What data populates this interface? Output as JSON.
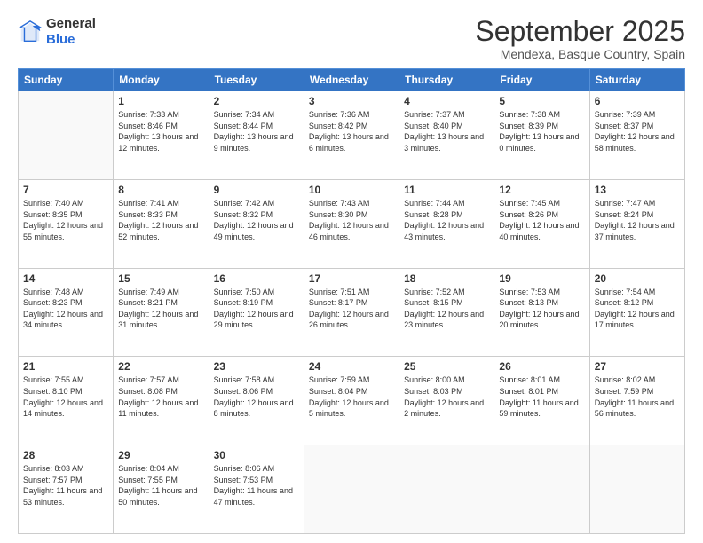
{
  "logo": {
    "general": "General",
    "blue": "Blue"
  },
  "title": {
    "month": "September 2025",
    "location": "Mendexa, Basque Country, Spain"
  },
  "weekdays": [
    "Sunday",
    "Monday",
    "Tuesday",
    "Wednesday",
    "Thursday",
    "Friday",
    "Saturday"
  ],
  "weeks": [
    [
      {
        "day": "",
        "sunrise": "",
        "sunset": "",
        "daylight": ""
      },
      {
        "day": "1",
        "sunrise": "Sunrise: 7:33 AM",
        "sunset": "Sunset: 8:46 PM",
        "daylight": "Daylight: 13 hours and 12 minutes."
      },
      {
        "day": "2",
        "sunrise": "Sunrise: 7:34 AM",
        "sunset": "Sunset: 8:44 PM",
        "daylight": "Daylight: 13 hours and 9 minutes."
      },
      {
        "day": "3",
        "sunrise": "Sunrise: 7:36 AM",
        "sunset": "Sunset: 8:42 PM",
        "daylight": "Daylight: 13 hours and 6 minutes."
      },
      {
        "day": "4",
        "sunrise": "Sunrise: 7:37 AM",
        "sunset": "Sunset: 8:40 PM",
        "daylight": "Daylight: 13 hours and 3 minutes."
      },
      {
        "day": "5",
        "sunrise": "Sunrise: 7:38 AM",
        "sunset": "Sunset: 8:39 PM",
        "daylight": "Daylight: 13 hours and 0 minutes."
      },
      {
        "day": "6",
        "sunrise": "Sunrise: 7:39 AM",
        "sunset": "Sunset: 8:37 PM",
        "daylight": "Daylight: 12 hours and 58 minutes."
      }
    ],
    [
      {
        "day": "7",
        "sunrise": "Sunrise: 7:40 AM",
        "sunset": "Sunset: 8:35 PM",
        "daylight": "Daylight: 12 hours and 55 minutes."
      },
      {
        "day": "8",
        "sunrise": "Sunrise: 7:41 AM",
        "sunset": "Sunset: 8:33 PM",
        "daylight": "Daylight: 12 hours and 52 minutes."
      },
      {
        "day": "9",
        "sunrise": "Sunrise: 7:42 AM",
        "sunset": "Sunset: 8:32 PM",
        "daylight": "Daylight: 12 hours and 49 minutes."
      },
      {
        "day": "10",
        "sunrise": "Sunrise: 7:43 AM",
        "sunset": "Sunset: 8:30 PM",
        "daylight": "Daylight: 12 hours and 46 minutes."
      },
      {
        "day": "11",
        "sunrise": "Sunrise: 7:44 AM",
        "sunset": "Sunset: 8:28 PM",
        "daylight": "Daylight: 12 hours and 43 minutes."
      },
      {
        "day": "12",
        "sunrise": "Sunrise: 7:45 AM",
        "sunset": "Sunset: 8:26 PM",
        "daylight": "Daylight: 12 hours and 40 minutes."
      },
      {
        "day": "13",
        "sunrise": "Sunrise: 7:47 AM",
        "sunset": "Sunset: 8:24 PM",
        "daylight": "Daylight: 12 hours and 37 minutes."
      }
    ],
    [
      {
        "day": "14",
        "sunrise": "Sunrise: 7:48 AM",
        "sunset": "Sunset: 8:23 PM",
        "daylight": "Daylight: 12 hours and 34 minutes."
      },
      {
        "day": "15",
        "sunrise": "Sunrise: 7:49 AM",
        "sunset": "Sunset: 8:21 PM",
        "daylight": "Daylight: 12 hours and 31 minutes."
      },
      {
        "day": "16",
        "sunrise": "Sunrise: 7:50 AM",
        "sunset": "Sunset: 8:19 PM",
        "daylight": "Daylight: 12 hours and 29 minutes."
      },
      {
        "day": "17",
        "sunrise": "Sunrise: 7:51 AM",
        "sunset": "Sunset: 8:17 PM",
        "daylight": "Daylight: 12 hours and 26 minutes."
      },
      {
        "day": "18",
        "sunrise": "Sunrise: 7:52 AM",
        "sunset": "Sunset: 8:15 PM",
        "daylight": "Daylight: 12 hours and 23 minutes."
      },
      {
        "day": "19",
        "sunrise": "Sunrise: 7:53 AM",
        "sunset": "Sunset: 8:13 PM",
        "daylight": "Daylight: 12 hours and 20 minutes."
      },
      {
        "day": "20",
        "sunrise": "Sunrise: 7:54 AM",
        "sunset": "Sunset: 8:12 PM",
        "daylight": "Daylight: 12 hours and 17 minutes."
      }
    ],
    [
      {
        "day": "21",
        "sunrise": "Sunrise: 7:55 AM",
        "sunset": "Sunset: 8:10 PM",
        "daylight": "Daylight: 12 hours and 14 minutes."
      },
      {
        "day": "22",
        "sunrise": "Sunrise: 7:57 AM",
        "sunset": "Sunset: 8:08 PM",
        "daylight": "Daylight: 12 hours and 11 minutes."
      },
      {
        "day": "23",
        "sunrise": "Sunrise: 7:58 AM",
        "sunset": "Sunset: 8:06 PM",
        "daylight": "Daylight: 12 hours and 8 minutes."
      },
      {
        "day": "24",
        "sunrise": "Sunrise: 7:59 AM",
        "sunset": "Sunset: 8:04 PM",
        "daylight": "Daylight: 12 hours and 5 minutes."
      },
      {
        "day": "25",
        "sunrise": "Sunrise: 8:00 AM",
        "sunset": "Sunset: 8:03 PM",
        "daylight": "Daylight: 12 hours and 2 minutes."
      },
      {
        "day": "26",
        "sunrise": "Sunrise: 8:01 AM",
        "sunset": "Sunset: 8:01 PM",
        "daylight": "Daylight: 11 hours and 59 minutes."
      },
      {
        "day": "27",
        "sunrise": "Sunrise: 8:02 AM",
        "sunset": "Sunset: 7:59 PM",
        "daylight": "Daylight: 11 hours and 56 minutes."
      }
    ],
    [
      {
        "day": "28",
        "sunrise": "Sunrise: 8:03 AM",
        "sunset": "Sunset: 7:57 PM",
        "daylight": "Daylight: 11 hours and 53 minutes."
      },
      {
        "day": "29",
        "sunrise": "Sunrise: 8:04 AM",
        "sunset": "Sunset: 7:55 PM",
        "daylight": "Daylight: 11 hours and 50 minutes."
      },
      {
        "day": "30",
        "sunrise": "Sunrise: 8:06 AM",
        "sunset": "Sunset: 7:53 PM",
        "daylight": "Daylight: 11 hours and 47 minutes."
      },
      {
        "day": "",
        "sunrise": "",
        "sunset": "",
        "daylight": ""
      },
      {
        "day": "",
        "sunrise": "",
        "sunset": "",
        "daylight": ""
      },
      {
        "day": "",
        "sunrise": "",
        "sunset": "",
        "daylight": ""
      },
      {
        "day": "",
        "sunrise": "",
        "sunset": "",
        "daylight": ""
      }
    ]
  ]
}
